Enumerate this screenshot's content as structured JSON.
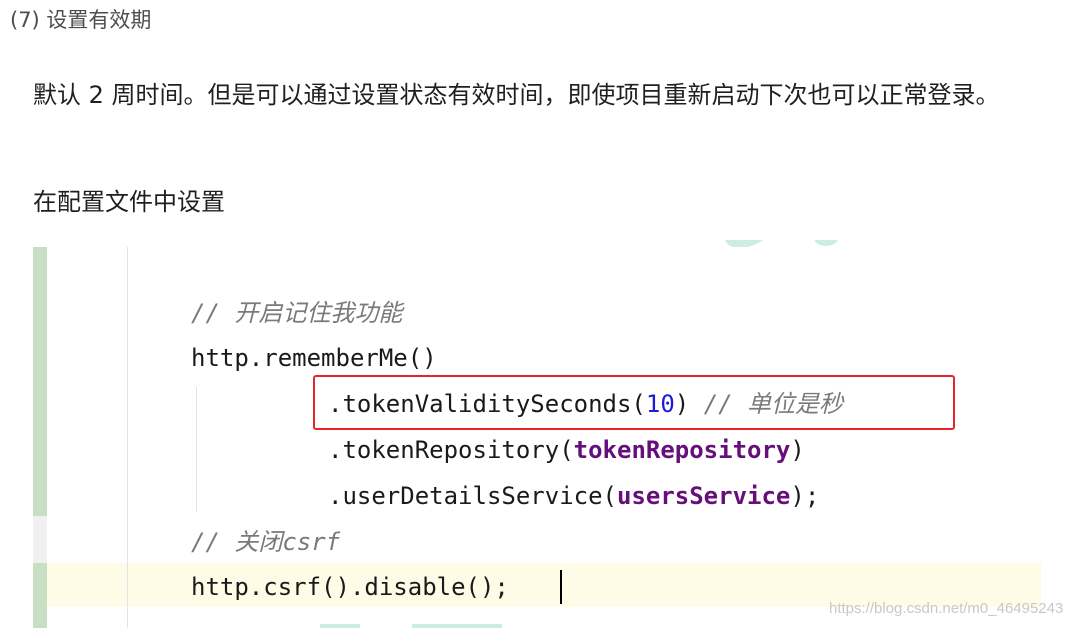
{
  "article": {
    "heading": "(7) 设置有效期",
    "paragraph": "默认 2 周时间。但是可以通过设置状态有效时间，即使项目重新启动下次也可以正常登录。",
    "paragraph2": "在配置文件中设置"
  },
  "code": {
    "comment_enable_remember": "// 开启记住我功能",
    "line_remember_me": "http.rememberMe()",
    "line_token_validity_prefix": ".tokenValiditySeconds(",
    "token_validity_value": "10",
    "line_token_validity_suffix": ")",
    "comment_unit_seconds": "// 单位是秒",
    "line_token_repository_prefix": ".tokenRepository(",
    "token_repository_arg": "tokenRepository",
    "line_token_repository_suffix": ")",
    "line_user_details_prefix": ".userDetailsService(",
    "users_service_arg": "usersService",
    "line_user_details_suffix": ");",
    "comment_disable_csrf": "// 关闭csrf",
    "line_csrf_disable": "http.csrf().disable();"
  },
  "watermark": "https://blog.csdn.net/m0_46495243",
  "colors": {
    "highlight_border": "#e8252b",
    "gutter": "#c7dfc2",
    "comment": "#7a7a7a",
    "number": "#1b1bd9",
    "field": "#660e7a",
    "current_line": "#fefce6"
  }
}
